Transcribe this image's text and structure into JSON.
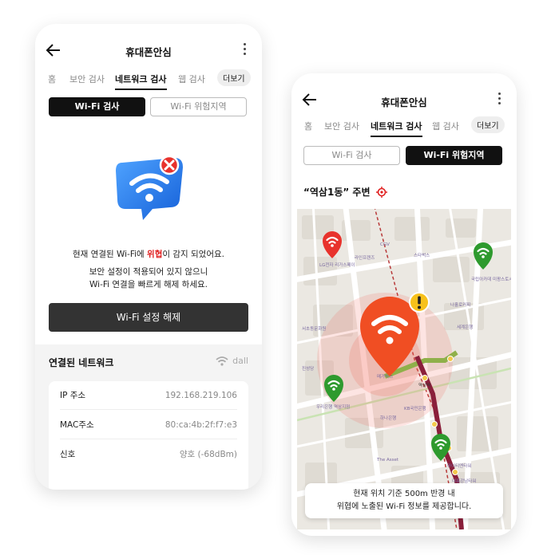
{
  "colors": {
    "accent": "#111111",
    "danger": "#e02020",
    "safe_pin": "#2e9a2e",
    "threat_pin": "#f04e23",
    "warning": "#f7c11b"
  },
  "screen1": {
    "title": "휴대폰안심",
    "tabs": [
      "홈",
      "보안 검사",
      "네트워크 검사",
      "웹 검사"
    ],
    "more": "더보기",
    "seg_left": "Wi-Fi 검사",
    "seg_right": "Wi-Fi 위험지역",
    "alert_prefix": "현재 연결된 Wi-Fi에 ",
    "alert_highlight": "위협",
    "alert_suffix": "이 감지 되었어요.",
    "advice_line1": "보안 설정이 적용되어 있지 않으니",
    "advice_line2": "Wi-Fi 연결을 빠르게 해제 하세요.",
    "cta": "Wi-Fi 설정 해제",
    "network_title": "연결된 네트워크",
    "ssid": "dall",
    "rows": [
      {
        "key": "IP 주소",
        "value": "192.168.219.106"
      },
      {
        "key": "MAC주소",
        "value": "80:ca:4b:2f:f7:e3"
      },
      {
        "key": "신호",
        "value": "양호 (-68dBm)"
      }
    ]
  },
  "screen2": {
    "title": "휴대폰안심",
    "tabs": [
      "홈",
      "보안 검사",
      "네트워크 검사",
      "웹 검사"
    ],
    "more": "더보기",
    "seg_left": "Wi-Fi 검사",
    "seg_right": "Wi-Fi 위험지역",
    "location": "“역삼1동” 주변",
    "map_labels": [
      "LG전자 리가스페이",
      "라인프렌즈",
      "CGV",
      "스타벅스",
      "국립아카데 미팡스토시관",
      "나홀로커피",
      "세계은행",
      "메가박스",
      "역삼역",
      "KB국민은행",
      "하나은행",
      "The Asset",
      "대륭강남타워",
      "아이티엔타워",
      "우리은행 역삼지점",
      "서초동문화원",
      "진성당"
    ],
    "info_line1": "현재 위치 기준 500m 반경 내",
    "info_line2": "위협에 노출된 Wi-Fi 정보를 제공합니다."
  }
}
